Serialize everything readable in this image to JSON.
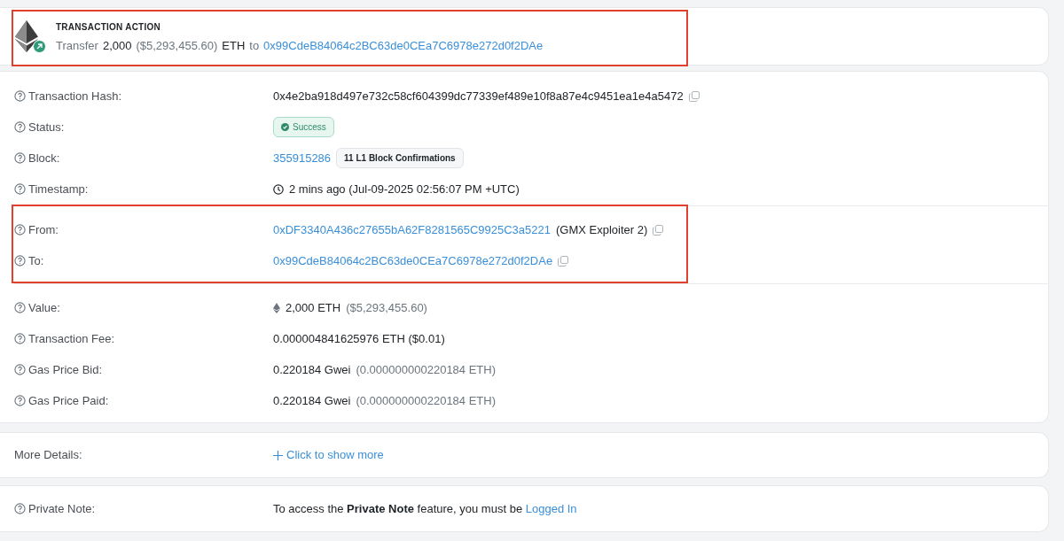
{
  "action": {
    "title": "TRANSACTION ACTION",
    "highlighted": true,
    "segments": [
      {
        "kind": "muted",
        "text": "Transfer"
      },
      {
        "kind": "strong",
        "text": "2,000"
      },
      {
        "kind": "muted",
        "text": "($5,293,455.60)"
      },
      {
        "kind": "strong",
        "text": "ETH"
      },
      {
        "kind": "muted",
        "text": "to"
      },
      {
        "kind": "link",
        "text": "0x99CdeB84064c2BC63de0CEa7C6978e272d0f2DAe"
      }
    ]
  },
  "groups": [
    {
      "highlighted": false,
      "rows": [
        {
          "label": "Transaction Hash:",
          "segments": [
            {
              "kind": "text",
              "text": "0x4e2ba918d497e732c58cf604399dc77339ef489e10f8a87e4c9451ea1e4a5472"
            },
            {
              "kind": "copy"
            }
          ]
        },
        {
          "label": "Status:",
          "segments": [
            {
              "kind": "success",
              "text": "Success"
            }
          ]
        },
        {
          "label": "Block:",
          "segments": [
            {
              "kind": "link",
              "text": "355915286"
            },
            {
              "kind": "badge",
              "text": "11 L1 Block Confirmations"
            }
          ]
        },
        {
          "label": "Timestamp:",
          "segments": [
            {
              "kind": "clock"
            },
            {
              "kind": "text",
              "text": "2 mins ago (Jul-09-2025 02:56:07 PM +UTC)"
            }
          ]
        }
      ]
    },
    {
      "highlighted": true,
      "rows": [
        {
          "label": "From:",
          "segments": [
            {
              "kind": "link",
              "text": "0xDF3340A436c27655bA62F8281565C9925C3a5221"
            },
            {
              "kind": "text",
              "text": "(GMX Exploiter 2)"
            },
            {
              "kind": "copy"
            }
          ]
        },
        {
          "label": "To:",
          "segments": [
            {
              "kind": "link",
              "text": "0x99CdeB84064c2BC63de0CEa7C6978e272d0f2DAe"
            },
            {
              "kind": "copy"
            }
          ]
        }
      ]
    },
    {
      "highlighted": false,
      "rows": [
        {
          "label": "Value:",
          "segments": [
            {
              "kind": "eth"
            },
            {
              "kind": "text",
              "text": "2,000 ETH"
            },
            {
              "kind": "muted",
              "text": "($5,293,455.60)"
            }
          ]
        },
        {
          "label": "Transaction Fee:",
          "segments": [
            {
              "kind": "text",
              "text": "0.000004841625976 ETH ($0.01)"
            }
          ]
        },
        {
          "label": "Gas Price Bid:",
          "segments": [
            {
              "kind": "text",
              "text": "0.220184 Gwei"
            },
            {
              "kind": "muted",
              "text": "(0.000000000220184 ETH)"
            }
          ]
        },
        {
          "label": "Gas Price Paid:",
          "segments": [
            {
              "kind": "text",
              "text": "0.220184 Gwei"
            },
            {
              "kind": "muted",
              "text": "(0.000000000220184 ETH)"
            }
          ]
        }
      ]
    }
  ],
  "more": {
    "label": "More Details:",
    "link": "Click to show more"
  },
  "note": {
    "label": "Private Note:",
    "text": "To access the **Private Note** feature, you must be",
    "link": "Logged In"
  }
}
